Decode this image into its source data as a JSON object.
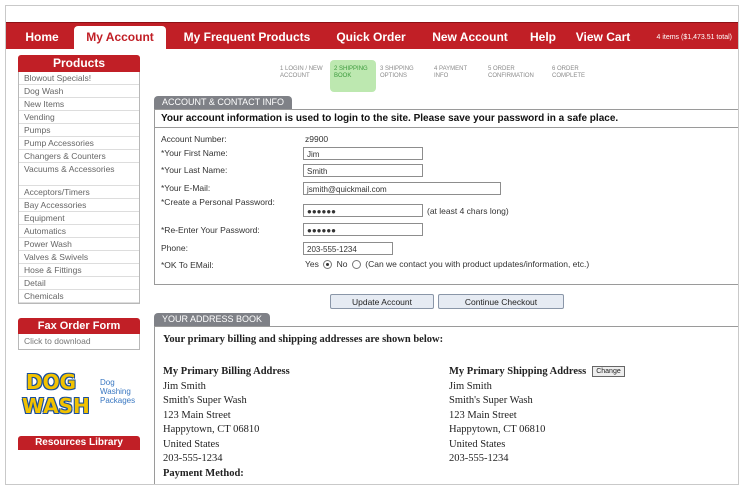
{
  "nav": {
    "tabs": [
      {
        "label": "Home"
      },
      {
        "label": "My Account"
      },
      {
        "label": "My Frequent Products"
      },
      {
        "label": "Quick Order"
      },
      {
        "label": "New Account"
      },
      {
        "label": "Help"
      },
      {
        "label": "View Cart"
      }
    ],
    "cart_info": "4 items ($1,473.51 total)"
  },
  "sidebar": {
    "products_header": "Products",
    "items": [
      "Blowout Specials!",
      "Dog Wash",
      "New Items",
      "Vending",
      "Pumps",
      "Pump Accessories",
      "Changers & Counters",
      "Vacuums & Accessories",
      "Acceptors/Timers",
      "Bay Accessories",
      "Equipment",
      "Automatics",
      "Power Wash",
      "Valves & Swivels",
      "Hose & Fittings",
      "Detail",
      "Chemicals"
    ],
    "fax_header": "Fax Order Form",
    "fax_link": "Click to download",
    "logo": {
      "word1": "DOG",
      "word2": "WASH",
      "tagline": "Dog Washing Packages"
    },
    "resources_header": "Resources Library"
  },
  "checkout_steps": [
    {
      "num": "1",
      "label": "LOGIN / NEW ACCOUNT"
    },
    {
      "num": "2",
      "label": "SHIPPING BOOK"
    },
    {
      "num": "3",
      "label": "SHIPPING OPTIONS"
    },
    {
      "num": "4",
      "label": "PAYMENT INFO"
    },
    {
      "num": "5",
      "label": "ORDER CONFIRMATION"
    },
    {
      "num": "6",
      "label": "ORDER COMPLETE"
    }
  ],
  "account": {
    "header": "ACCOUNT & CONTACT INFO",
    "notice": "Your account information is used to login to the site. Please save your password in a safe place.",
    "account_number_label": "Account Number:",
    "account_number": "z9900",
    "first_name_label": "*Your First Name:",
    "first_name": "Jim",
    "last_name_label": "*Your Last Name:",
    "last_name": "Smith",
    "email_label": "*Your E-Mail:",
    "email": "jsmith@quickmail.com",
    "password_label": "*Create a Personal Password:",
    "password": "●●●●●●",
    "password_hint": "(at least 4 chars long)",
    "password2_label": "*Re-Enter Your Password:",
    "password2": "●●●●●●",
    "phone_label": "Phone:",
    "phone": "203-555-1234",
    "ok_email_label": "*OK To EMail:",
    "yes_label": "Yes",
    "no_label": "No",
    "ok_email_note": "(Can we contact you with product updates/information, etc.)",
    "update_button": "Update Account",
    "continue_button": "Continue Checkout"
  },
  "address_book": {
    "header": "YOUR ADDRESS BOOK",
    "intro": "Your primary billing and shipping addresses are shown below:",
    "billing": {
      "title": "My Primary Billing Address",
      "lines": [
        "Jim Smith",
        "Smith's Super Wash",
        "123 Main Street",
        "Happytown, CT 06810",
        "United States",
        "203-555-1234"
      ]
    },
    "shipping": {
      "title": "My Primary Shipping Address",
      "change_label": "Change",
      "lines": [
        "Jim Smith",
        "Smith's Super Wash",
        "123 Main Street",
        "Happytown, CT 06810",
        "United States",
        "203-555-1234"
      ]
    },
    "payment_label": "Payment Method:"
  }
}
